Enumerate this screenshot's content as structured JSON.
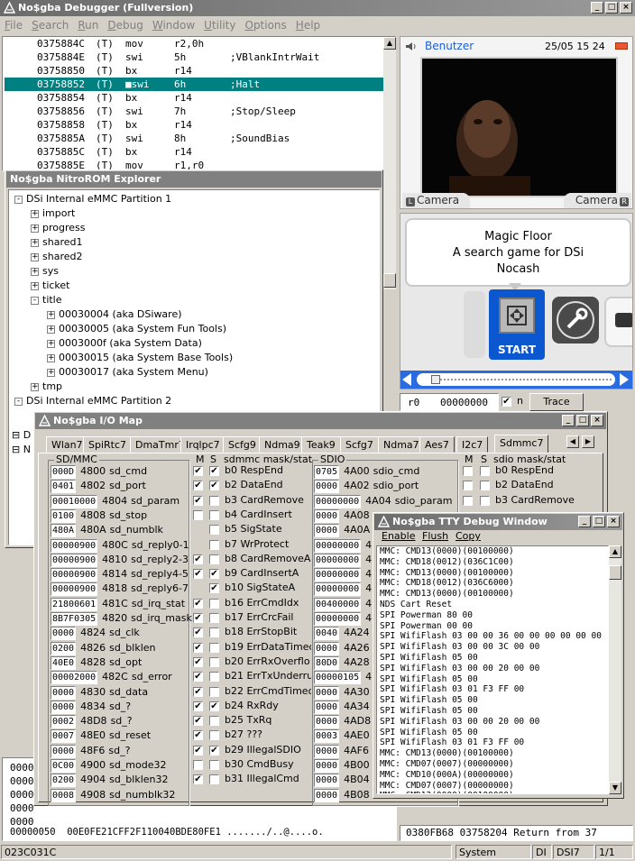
{
  "main_window": {
    "title": "No$gba Debugger (Fullversion)",
    "menu": [
      "File",
      "Search",
      "Run",
      "Debug",
      "Window",
      "Utility",
      "Options",
      "Help"
    ]
  },
  "disasm": [
    {
      "addr": "0375884C",
      "mode": "(T)",
      "op": "mov",
      "args": "r2,0h",
      "comment": ""
    },
    {
      "addr": "0375884E",
      "mode": "(T)",
      "op": "swi",
      "args": "5h",
      "comment": ";VBlankIntrWait"
    },
    {
      "addr": "03758850",
      "mode": "(T)",
      "op": "bx",
      "args": "r14",
      "comment": ""
    },
    {
      "addr": "03758852",
      "mode": "(T)",
      "op": "■swi",
      "args": "6h",
      "comment": ";Halt"
    },
    {
      "addr": "03758854",
      "mode": "(T)",
      "op": "bx",
      "args": "r14",
      "comment": ""
    },
    {
      "addr": "03758856",
      "mode": "(T)",
      "op": "swi",
      "args": "7h",
      "comment": ";Stop/Sleep"
    },
    {
      "addr": "03758858",
      "mode": "(T)",
      "op": "bx",
      "args": "r14",
      "comment": ""
    },
    {
      "addr": "0375885A",
      "mode": "(T)",
      "op": "swi",
      "args": "8h",
      "comment": ";SoundBias"
    },
    {
      "addr": "0375885C",
      "mode": "(T)",
      "op": "bx",
      "args": "r14",
      "comment": ""
    },
    {
      "addr": "0375885E",
      "mode": "(T)",
      "op": "mov",
      "args": "r1,r0",
      "comment": ""
    }
  ],
  "dsi_screen": {
    "user": "Benutzer",
    "datetime": "25/05 15 24",
    "camera_left": "Camera",
    "camera_right": "Camera",
    "app_title_1": "Magic Floor",
    "app_title_2": "A search game for DSi",
    "app_title_3": "Nocash",
    "start_label": "START"
  },
  "reg_row": {
    "reg": "r0",
    "value": "00000000",
    "chk_label": "n",
    "trace_label": "Trace"
  },
  "nitrorom": {
    "title": "No$gba NitroROM Explorer",
    "rows": [
      {
        "level": 0,
        "sign": "-",
        "label": "DSi Internal eMMC Partition 1"
      },
      {
        "level": 1,
        "sign": "+",
        "label": "import"
      },
      {
        "level": 1,
        "sign": "+",
        "label": "progress"
      },
      {
        "level": 1,
        "sign": "+",
        "label": "shared1"
      },
      {
        "level": 1,
        "sign": "+",
        "label": "shared2"
      },
      {
        "level": 1,
        "sign": "+",
        "label": "sys"
      },
      {
        "level": 1,
        "sign": "+",
        "label": "ticket"
      },
      {
        "level": 1,
        "sign": "-",
        "label": "title"
      },
      {
        "level": 2,
        "sign": "+",
        "label": "00030004 (aka DSiware)"
      },
      {
        "level": 2,
        "sign": "+",
        "label": "00030005 (aka System Fun Tools)"
      },
      {
        "level": 2,
        "sign": "+",
        "label": "0003000f (aka System Data)"
      },
      {
        "level": 2,
        "sign": "+",
        "label": "00030015 (aka System Base Tools)"
      },
      {
        "level": 2,
        "sign": "+",
        "label": "00030017 (aka System Menu)"
      },
      {
        "level": 1,
        "sign": "+",
        "label": "tmp"
      },
      {
        "level": 0,
        "sign": "-",
        "label": "DSi Internal eMMC Partition 2"
      }
    ]
  },
  "iomap": {
    "title": "No$gba I/O Map",
    "tabs": [
      "Wlan7",
      "SpiRtc7",
      "DmaTmr7",
      "Irqlpc7",
      "Scfg9",
      "Ndma9",
      "Teak9",
      "Scfg7",
      "Ndma7",
      "Aes7",
      "I2c7",
      "Sdmmc7"
    ],
    "sd_group": "SD/MMC",
    "sd_rows": [
      {
        "val": "000D",
        "addr": "4800",
        "name": "sd_cmd"
      },
      {
        "val": "0401",
        "addr": "4802",
        "name": "sd_port"
      },
      {
        "val": "00010000",
        "addr": "4804",
        "name": "sd_param"
      },
      {
        "val": "0100",
        "addr": "4808",
        "name": "sd_stop"
      },
      {
        "val": "480A",
        "addr": "480A",
        "name": "sd_numblk"
      },
      {
        "val": "00000900",
        "addr": "480C",
        "name": "sd_reply0-1"
      },
      {
        "val": "00000900",
        "addr": "4810",
        "name": "sd_reply2-3"
      },
      {
        "val": "00000900",
        "addr": "4814",
        "name": "sd_reply4-5"
      },
      {
        "val": "00000900",
        "addr": "4818",
        "name": "sd_reply6-7"
      },
      {
        "val": "21800601",
        "addr": "481C",
        "name": "sd_irq_stat"
      },
      {
        "val": "8B7F0305",
        "addr": "4820",
        "name": "sd_irq_mask"
      },
      {
        "val": "0000",
        "addr": "4824",
        "name": "sd_clk"
      },
      {
        "val": "0200",
        "addr": "4826",
        "name": "sd_blklen"
      },
      {
        "val": "40E0",
        "addr": "4828",
        "name": "sd_opt"
      },
      {
        "val": "00002000",
        "addr": "482C",
        "name": "sd_error"
      },
      {
        "val": "0000",
        "addr": "4830",
        "name": "sd_data"
      },
      {
        "val": "0000",
        "addr": "4834",
        "name": "sd_?"
      },
      {
        "val": "0002",
        "addr": "48D8",
        "name": "sd_?"
      },
      {
        "val": "0007",
        "addr": "48E0",
        "name": "sd_reset"
      },
      {
        "val": "0000",
        "addr": "48F6",
        "name": "sd_?"
      },
      {
        "val": "0C00",
        "addr": "4900",
        "name": "sd_mode32"
      },
      {
        "val": "0200",
        "addr": "4904",
        "name": "sd_blklen32"
      },
      {
        "val": "0008",
        "addr": "4908",
        "name": "sd_numblk32"
      }
    ],
    "mask_header": {
      "m": "M",
      "s": "S",
      "label": "sdmmc mask/stat"
    },
    "mask_rows": [
      {
        "m": true,
        "s": true,
        "label": "b0 RespEnd"
      },
      {
        "m": true,
        "s": true,
        "label": "b2 DataEnd"
      },
      {
        "m": true,
        "s": false,
        "label": "b3 CardRemove"
      },
      {
        "m": false,
        "s": false,
        "label": "b4 CardInsert"
      },
      {
        "m": null,
        "s": false,
        "label": "b5 SigState"
      },
      {
        "m": null,
        "s": false,
        "label": "b7 WrProtect"
      },
      {
        "m": true,
        "s": false,
        "label": "b8 CardRemoveA"
      },
      {
        "m": true,
        "s": true,
        "label": "b9 CardInsertA"
      },
      {
        "m": null,
        "s": true,
        "label": "b10 SigStateA"
      },
      {
        "m": true,
        "s": false,
        "label": "b16 ErrCmdIdx"
      },
      {
        "m": true,
        "s": false,
        "label": "b17 ErrCrcFail"
      },
      {
        "m": true,
        "s": false,
        "label": "b18 ErrStopBit"
      },
      {
        "m": true,
        "s": false,
        "label": "b19 ErrDataTimec"
      },
      {
        "m": true,
        "s": false,
        "label": "b20 ErrRxOverflo"
      },
      {
        "m": true,
        "s": false,
        "label": "b21 ErrTxUnderru"
      },
      {
        "m": true,
        "s": false,
        "label": "b22 ErrCmdTimeo"
      },
      {
        "m": true,
        "s": true,
        "label": "b24 RxRdy"
      },
      {
        "m": true,
        "s": false,
        "label": "b25 TxRq"
      },
      {
        "m": true,
        "s": false,
        "label": "b27 ???"
      },
      {
        "m": true,
        "s": true,
        "label": "b29 IllegalSDIO"
      },
      {
        "m": false,
        "s": false,
        "label": "b30 CmdBusy"
      },
      {
        "m": true,
        "s": false,
        "label": "b31 IllegalCmd"
      }
    ],
    "sdio_group": "SDIO",
    "sdio_rows": [
      {
        "val": "0705",
        "addr": "4A00",
        "name": "sdio_cmd"
      },
      {
        "val": "0000",
        "addr": "4A02",
        "name": "sdio_port"
      },
      {
        "val": "00000000",
        "addr": "4A04",
        "name": "sdio_param"
      },
      {
        "val": "0000",
        "addr": "4A08",
        "name": ""
      },
      {
        "val": "0000",
        "addr": "4A0A",
        "name": ""
      },
      {
        "val": "00000000",
        "addr": "4",
        "name": ""
      },
      {
        "val": "00000000",
        "addr": "4",
        "name": ""
      },
      {
        "val": "00000000",
        "addr": "4",
        "name": ""
      },
      {
        "val": "00000000",
        "addr": "4",
        "name": ""
      },
      {
        "val": "00400000",
        "addr": "4",
        "name": ""
      },
      {
        "val": "00000000",
        "addr": "4",
        "name": ""
      },
      {
        "val": "0040",
        "addr": "4A24",
        "name": ""
      },
      {
        "val": "0000",
        "addr": "4A26",
        "name": ""
      },
      {
        "val": "80D0",
        "addr": "4A28",
        "name": ""
      },
      {
        "val": "00000105",
        "addr": "4",
        "name": ""
      },
      {
        "val": "0000",
        "addr": "4A30",
        "name": ""
      },
      {
        "val": "0000",
        "addr": "4A34",
        "name": ""
      },
      {
        "val": "0000",
        "addr": "4AD8",
        "name": ""
      },
      {
        "val": "0003",
        "addr": "4AE0",
        "name": ""
      },
      {
        "val": "0000",
        "addr": "4AF6",
        "name": ""
      },
      {
        "val": "0000",
        "addr": "4B00",
        "name": ""
      },
      {
        "val": "0000",
        "addr": "4B04",
        "name": ""
      },
      {
        "val": "0000",
        "addr": "4B08",
        "name": ""
      }
    ],
    "sdio_mask_header": {
      "m": "M",
      "s": "S",
      "label": "sdio mask/stat"
    },
    "sdio_mask_rows": [
      {
        "label": "b0 RespEnd"
      },
      {
        "label": "b2 DataEnd"
      },
      {
        "label": "b3 CardRemove"
      }
    ]
  },
  "tty": {
    "title": "No$gba TTY Debug Window",
    "menu": [
      "Enable",
      "Flush",
      "Copy"
    ],
    "lines": [
      "MMC: CMD13(0000)(00100000)",
      "MMC: CMD18(0012)(036C1C00)",
      "MMC: CMD13(0000)(00100000)",
      "MMC: CMD18(0012)(036C6000)",
      "MMC: CMD13(0000)(00100000)",
      "NDS Cart Reset",
      "SPI Powerman 80 00",
      "SPI Powerman 00 00",
      "SPI WifiFlash 03 00 00 36 00 00 00 00 00 00",
      "SPI WifiFlash 03 00 00 3C 00 00",
      "SPI WifiFlash 05 00",
      "SPI WifiFlash 03 00 00 20 00 00",
      "SPI WifiFlash 05 00",
      "SPI WifiFlash 03 01 F3 FF 00",
      "SPI WifiFlash 05 00",
      "SPI WifiFlash 05 00",
      "SPI WifiFlash 03 00 00 20 00 00",
      "SPI WifiFlash 05 00",
      "SPI WifiFlash 03 01 F3 FF 00",
      "MMC: CMD13(0000)(00100000)",
      "MMC: CMD07(0007)(00000000)",
      "MMC: CMD10(000A)(00000000)",
      "MMC: CMD07(0007)(00000000)",
      "MMC: CMD13(0000)(00100000)"
    ]
  },
  "hexdump": [
    "0000",
    "0000",
    "0000",
    "0000",
    "0000"
  ],
  "hex_last": "00000050  00E0FE21CFF2F110040BDE80FE1 ......./..@....o.",
  "hex_right_prefix": "4",
  "stack_line": "0380FB68 03758204 Return from 37",
  "status": {
    "left": "023C031C",
    "middle": "System",
    "di": "DI",
    "cpu": "DSI7",
    "page": "1/1"
  },
  "colors": {
    "selection": "#008080",
    "titlebar": "#808080",
    "dsi_blue": "#1a5fd6",
    "start_blue": "#0b57d0"
  }
}
